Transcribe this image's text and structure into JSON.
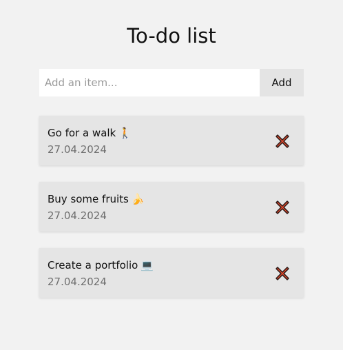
{
  "header": {
    "title": "To-do list"
  },
  "new_item": {
    "placeholder": "Add an item...",
    "value": "",
    "add_label": "Add"
  },
  "todos": [
    {
      "text": "Go for a walk",
      "emoji": "🚶",
      "date": "27.04.2024"
    },
    {
      "text": "Buy some fruits",
      "emoji": "🍌",
      "date": "27.04.2024"
    },
    {
      "text": "Create a portfolio",
      "emoji": "💻",
      "date": "27.04.2024"
    }
  ],
  "icons": {
    "delete": "cross-mark-icon"
  },
  "colors": {
    "background": "#f2f2f2",
    "card": "#e5e5e5",
    "delete_red": "#e0492c"
  }
}
